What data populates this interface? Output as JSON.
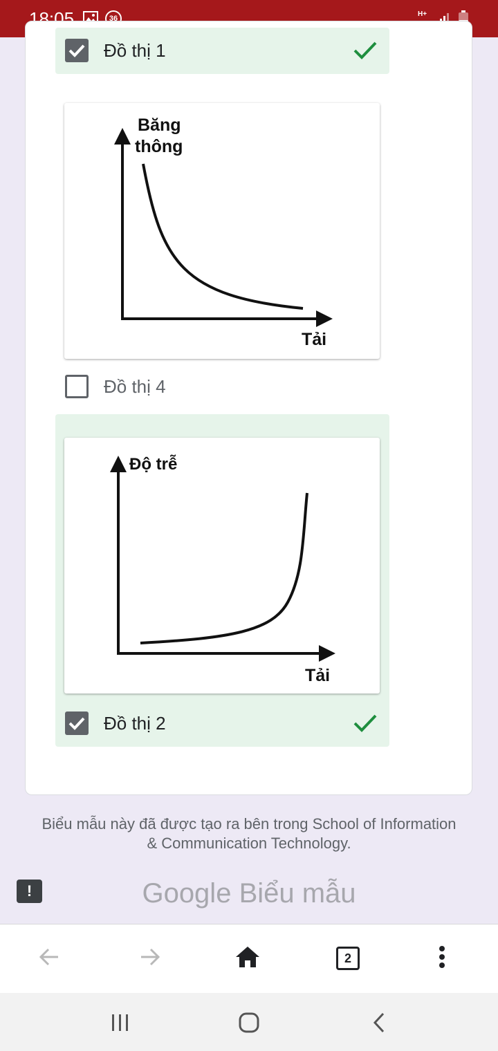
{
  "status_bar": {
    "time": "18:05",
    "notification_count": "36",
    "network": "H+"
  },
  "options": [
    {
      "label": "Đồ thị 1",
      "checked": true,
      "correct": true
    },
    {
      "label": "Đồ thị 4",
      "checked": false,
      "correct": false
    },
    {
      "label": "Đồ thị 2",
      "checked": true,
      "correct": true
    }
  ],
  "graph_4": {
    "y_label_line1": "Băng",
    "y_label_line2": "thông",
    "x_label": "Tải"
  },
  "graph_2": {
    "y_label": "Độ trễ",
    "x_label": "Tải"
  },
  "footer": {
    "note": "Biểu mẫu này đã được tạo ra bên trong School of Information & Communication Technology.",
    "brand_google": "Google",
    "brand_forms": "Biểu mẫu"
  },
  "toolbar": {
    "tab_count": "2"
  },
  "colors": {
    "status_bar": "#a5181b",
    "correct": "#1e8e3e",
    "highlight": "#e6f4ea"
  },
  "icons": [
    "photo-icon",
    "signal-icon",
    "battery-icon",
    "check-icon",
    "report-icon",
    "back-arrow-icon",
    "forward-arrow-icon",
    "home-icon",
    "menu-icon",
    "recents-icon",
    "nav-home-icon",
    "nav-back-icon"
  ]
}
